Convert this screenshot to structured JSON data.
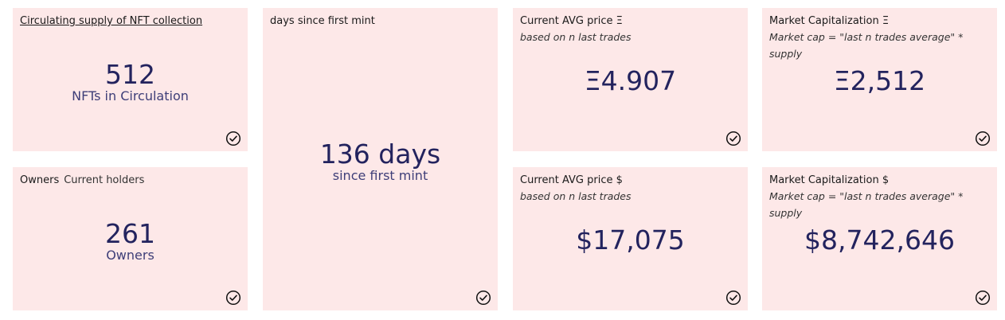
{
  "cards": {
    "supply": {
      "title": "Circulating supply of NFT collection",
      "value": "512",
      "unit": "NFTs in Circulation"
    },
    "owners": {
      "title": "Owners",
      "subtitle": "Current holders",
      "value": "261",
      "unit": "Owners"
    },
    "days": {
      "title": "days since first mint",
      "value": "136 days",
      "unit": "since first mint"
    },
    "avg_price_eth": {
      "title": "Current AVG price Ξ",
      "subtitle": "based on n last trades",
      "value": "Ξ4.907"
    },
    "avg_price_usd": {
      "title": "Current AVG price $",
      "subtitle": "based on n last trades",
      "value": "$17,075"
    },
    "mcap_eth": {
      "title": "Market Capitalization Ξ",
      "subtitle": "Market cap = \"last n trades average\" * supply",
      "value": "Ξ2,512"
    },
    "mcap_usd": {
      "title": "Market Capitalization $",
      "subtitle": "Market cap = \"last n trades average\" * supply",
      "value": "$8,742,646"
    }
  },
  "icons": {
    "status": "check-circle-icon"
  },
  "colors": {
    "card_bg": "#fde8e8",
    "metric": "#23235e"
  }
}
